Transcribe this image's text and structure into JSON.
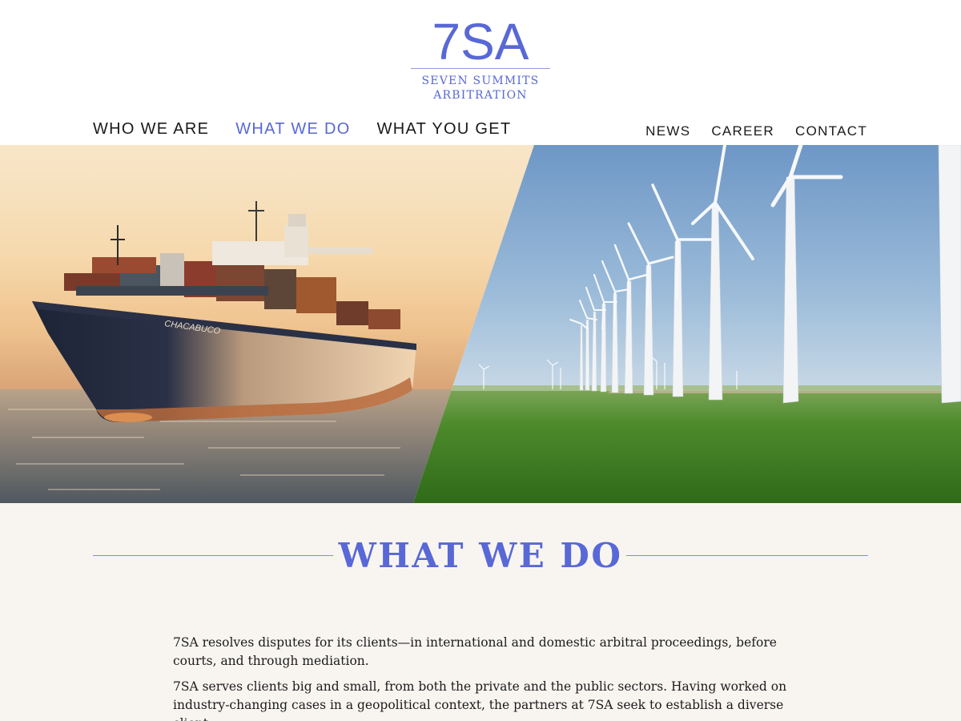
{
  "brand": {
    "mark": "7SA",
    "name_line1": "SEVEN SUMMITS",
    "name_line2": "ARBITRATION",
    "accent_color": "#5868d6"
  },
  "nav": {
    "primary": [
      {
        "label": "WHO WE ARE",
        "active": false
      },
      {
        "label": "WHAT WE DO",
        "active": true
      },
      {
        "label": "WHAT YOU GET",
        "active": false
      }
    ],
    "secondary": [
      {
        "label": "NEWS"
      },
      {
        "label": "CAREER"
      },
      {
        "label": "CONTACT"
      }
    ]
  },
  "hero": {
    "ship_name": "CHACABUCO"
  },
  "section": {
    "title": "WHAT WE DO",
    "paragraphs": [
      "7SA resolves disputes for its clients—in international and domestic arbitral proceedings, before courts, and through mediation.",
      "7SA serves clients big and small, from both the private and the public sectors. Having worked on industry-changing cases in a geopolitical context, the partners at 7SA seek to establish a diverse client"
    ]
  }
}
